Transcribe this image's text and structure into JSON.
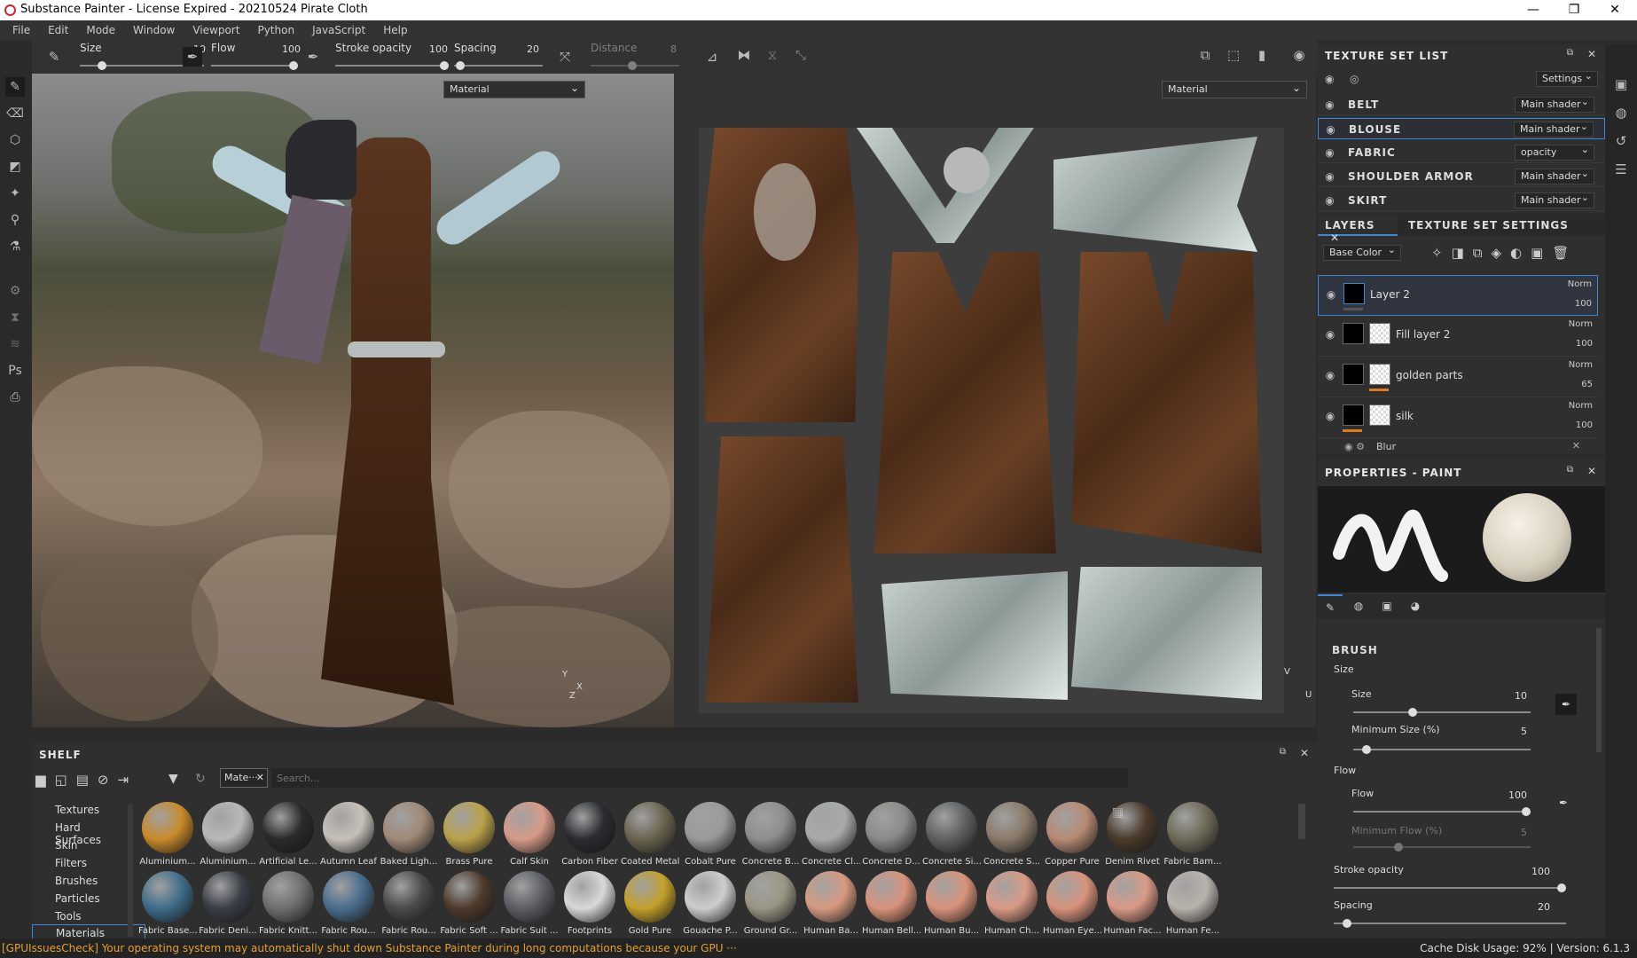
{
  "window": {
    "title": "Substance Painter - License Expired - 20210524 Pirate Cloth",
    "controls": [
      "—",
      "❐",
      "✕"
    ]
  },
  "menu": [
    "File",
    "Edit",
    "Mode",
    "Window",
    "Viewport",
    "Python",
    "JavaScript",
    "Help"
  ],
  "toolbar": {
    "size": {
      "label": "Size",
      "value": "10"
    },
    "flow": {
      "label": "Flow",
      "value": "100"
    },
    "stroke_opacity": {
      "label": "Stroke opacity",
      "value": "100"
    },
    "spacing": {
      "label": "Spacing",
      "value": "20"
    },
    "distance": {
      "label": "Distance",
      "value": "8"
    }
  },
  "viewport3d": {
    "channel": "Material",
    "axes": {
      "y": "Y",
      "z": "Z",
      "x": "X"
    }
  },
  "viewport2d": {
    "channel": "Material",
    "axes": {
      "v": "V",
      "u": "U"
    }
  },
  "texture_set_list": {
    "title": "TEXTURE SET LIST",
    "settings_label": "Settings",
    "sets": [
      {
        "name": "BELT",
        "shader": "Main shader"
      },
      {
        "name": "BLOUSE",
        "shader": "Main shader",
        "selected": true
      },
      {
        "name": "FABRIC",
        "shader": "opacity"
      },
      {
        "name": "SHOULDER ARMOR",
        "shader": "Main shader"
      },
      {
        "name": "SKIRT",
        "shader": "Main shader"
      }
    ]
  },
  "layers": {
    "tabs": [
      "LAYERS",
      "TEXTURE SET SETTINGS"
    ],
    "channel": "Base Color",
    "items": [
      {
        "name": "Layer 2",
        "blend": "Norm",
        "opacity": "100",
        "selected": true
      },
      {
        "name": "Fill layer 2",
        "blend": "Norm",
        "opacity": "100"
      },
      {
        "name": "golden parts",
        "blend": "Norm",
        "opacity": "65"
      },
      {
        "name": "silk",
        "blend": "Norm",
        "opacity": "100"
      },
      {
        "name": "Blur",
        "blend": "",
        "opacity": ""
      }
    ]
  },
  "properties": {
    "title": "PROPERTIES - PAINT",
    "section": "BRUSH",
    "groups": [
      {
        "name": "Size",
        "fields": [
          {
            "label": "Size",
            "value": "10"
          },
          {
            "label": "Minimum Size (%)",
            "value": "5"
          }
        ]
      },
      {
        "name": "Flow",
        "fields": [
          {
            "label": "Flow",
            "value": "100"
          },
          {
            "label": "Minimum Flow (%)",
            "value": "5"
          }
        ]
      }
    ],
    "stroke_opacity": {
      "label": "Stroke opacity",
      "value": "100"
    },
    "spacing": {
      "label": "Spacing",
      "value": "20"
    }
  },
  "shelf": {
    "title": "SHELF",
    "filter_chip": "Mate···",
    "search_placeholder": "Search...",
    "categories": [
      "Textures",
      "Hard Surfaces",
      "Skin",
      "Filters",
      "Brushes",
      "Particles",
      "Tools",
      "Materials"
    ],
    "selected_category": "Materials",
    "materials_row1": [
      "Aluminium...",
      "Aluminium...",
      "Artificial Le...",
      "Autumn Leaf",
      "Baked Ligh...",
      "Brass Pure",
      "Calf Skin",
      "Carbon Fiber",
      "Coated Metal",
      "Cobalt Pure",
      "Concrete B...",
      "Concrete Cl...",
      "Concrete D...",
      "Concrete Si...",
      "Concrete S...",
      "Copper Pure",
      "Denim Rivet",
      "Fabric Bam..."
    ],
    "materials_row2": [
      "Fabric Base...",
      "Fabric Deni...",
      "Fabric Knitt...",
      "Fabric Rou...",
      "Fabric Rou...",
      "Fabric Soft ...",
      "Fabric Suit ...",
      "Footprints",
      "Gold Pure",
      "Gouache P...",
      "Ground Gr...",
      "Human Ba...",
      "Human Bell...",
      "Human Bu...",
      "Human Ch...",
      "Human Eye...",
      "Human Fac...",
      "Human Fe..."
    ]
  },
  "status": {
    "warning": "[GPUIssuesCheck] Your operating system may automatically shut down Substance Painter during long computations because your GPU ···",
    "cache": "Cache Disk Usage:    92%  |  Version: 6.1.3"
  }
}
